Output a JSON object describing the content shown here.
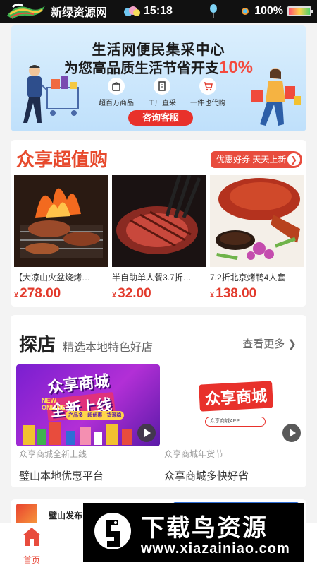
{
  "status_bar": {
    "site_name": "新绿资源网",
    "time": "15:18",
    "battery": "100%"
  },
  "banner": {
    "line1": "生活网便民集采中心",
    "line2_prefix": "为您高品质生活节省开支",
    "line2_highlight": "10%",
    "features": [
      {
        "label": "超百万商品",
        "icon": "bag-icon"
      },
      {
        "label": "工厂直采",
        "icon": "document-icon"
      },
      {
        "label": "一件也代购",
        "icon": "cart-icon"
      }
    ],
    "cta": "咨询客服",
    "colors": {
      "accent": "#e8312b",
      "background": "#cde8fc"
    }
  },
  "deals": {
    "title": "众享超值购",
    "tag": "优惠好券 天天上新",
    "items": [
      {
        "name": "【大凉山火盆烧烤…",
        "currency": "¥",
        "price": "278.00"
      },
      {
        "name": "半自助单人餐3.7折…",
        "currency": "¥",
        "price": "32.00"
      },
      {
        "name": "7.2折北京烤鸭4人套",
        "currency": "¥",
        "price": "138.00"
      }
    ]
  },
  "explore": {
    "title": "探店",
    "subtitle": "精选本地特色好店",
    "more": "查看更多",
    "shops": [
      {
        "caption": "众享商城全新上线",
        "description": "璧山本地优惠平台",
        "img_line1": "众享商城",
        "img_line2": "全新上线",
        "img_badge": "NEW ONLINE",
        "img_ribbon": "产品多 · 超优惠 · 货源稳"
      },
      {
        "caption": "众享商城年货节",
        "description": "众享商城多快好省",
        "img_logo": "众享商城",
        "img_search": "众享商城APP"
      }
    ]
  },
  "news": {
    "source": "璧山发布"
  },
  "tabbar": {
    "home": "首页"
  },
  "watermark": {
    "title": "下载鸟资源",
    "url": "www.xiazainiao.com"
  }
}
